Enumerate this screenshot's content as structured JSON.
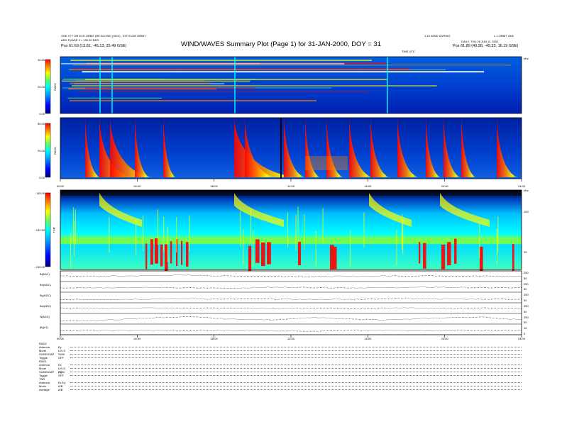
{
  "header": {
    "title": "WIND/WAVES Summary Plot (Page 1) for 31-JAN-2000, DOY = 31",
    "left_line1": "GSE X+Y OR ECE ORBIT (RE IN GSE) (GEO) - ATTITUDE ORBIT",
    "left_line2": "ARG PHASE 3 = 135.00 DEG",
    "left_line3": "Pos    61.69 (13.81, -45.13, 25.49 GSE)",
    "right_line1": "1.10 WIND DURING",
    "right_line2": "DAILY: THU 28 JUN 11, 2002",
    "right_line3": "Pos    61.89 (40.28, -45.33, 16.19 GSE)",
    "right_corner": "L 1 ORBIT orbit",
    "top_axis_label": "TIME UTC",
    "top_right_unit": "kHz"
  },
  "chart_data": [
    {
      "type": "heatmap",
      "name": "RAD2",
      "ylabel": "RAD2",
      "yticks": [
        "0.00",
        "20.00",
        "40.00"
      ],
      "ylim": [
        0,
        40
      ]
    },
    {
      "type": "heatmap",
      "name": "RAD1",
      "ylabel": "RAD1",
      "yticks": [
        "0.00",
        "20.00",
        "50.00"
      ],
      "ylim": [
        0,
        50
      ]
    },
    {
      "type": "heatmap",
      "name": "TNR",
      "ylabel": "TNR",
      "yticks": [
        "-150.00",
        "-132.50",
        "-115.00"
      ],
      "ylim": [
        -150,
        -115
      ],
      "right_ticks": [
        "100",
        "10"
      ],
      "right_unit": "kHz",
      "xticks": [
        "00:00",
        "04:00",
        "08:00",
        "12:00",
        "16:00",
        "20:00",
        "24:00"
      ]
    },
    {
      "type": "line",
      "name": "magnetometer-traces",
      "series": [
        {
          "name": "B(ADC)",
          "values": [
            0.52,
            0.5,
            0.55,
            0.6,
            0.52,
            0.5,
            0.48,
            0.5,
            0.53,
            0.55,
            0.51,
            0.5
          ]
        },
        {
          "name": "Bx(ADC)",
          "values": [
            0.4,
            0.42,
            0.45,
            0.4,
            0.38,
            0.46,
            0.44,
            0.41,
            0.43,
            0.47,
            0.42,
            0.4
          ]
        },
        {
          "name": "By(ADC)",
          "values": [
            0.3,
            0.32,
            0.35,
            0.38,
            0.34,
            0.36,
            0.31,
            0.33,
            0.4,
            0.37,
            0.35,
            0.33
          ]
        },
        {
          "name": "Bz(ADC)",
          "values": [
            0.5,
            0.48,
            0.52,
            0.49,
            0.51,
            0.47,
            0.5,
            0.46,
            0.52,
            0.48,
            0.5,
            0.49
          ]
        },
        {
          "name": "N(ADC)",
          "values": [
            0.3,
            0.35,
            0.55,
            0.7,
            0.48,
            0.4,
            0.62,
            0.45,
            0.4,
            0.58,
            0.66,
            0.42
          ]
        },
        {
          "name": "|B|(nT)",
          "values": [
            0.4,
            0.38,
            0.42,
            0.36,
            0.4,
            0.38,
            0.35,
            0.39,
            0.41,
            0.37,
            0.4,
            0.38
          ]
        }
      ],
      "right_ticks": [
        "250",
        "50",
        "250",
        "50",
        "250",
        "50",
        "250",
        "50",
        "250",
        "50",
        "10",
        "0"
      ],
      "xticks": [
        "00:00",
        "04:00",
        "08:00",
        "12:00",
        "16:00",
        "20:00",
        "24:00"
      ]
    }
  ],
  "settings": {
    "groups": [
      {
        "name": "RAD2",
        "rows": [
          {
            "label": "Antenna",
            "value": "Ey"
          },
          {
            "label": "Mode",
            "value": "LIN S"
          },
          {
            "label": "SUMD/GAP",
            "value": "SUM"
          },
          {
            "label": "Toggle",
            "value": "OFF"
          }
        ]
      },
      {
        "name": "RAD1",
        "rows": [
          {
            "label": "Antenna",
            "value": "Ex"
          },
          {
            "label": "Mode",
            "value": "LIN S (X)"
          },
          {
            "label": "SUMD/GAP",
            "value": "SUM"
          },
          {
            "label": "Toggle",
            "value": "OFF"
          }
        ]
      },
      {
        "name": "TNR",
        "rows": [
          {
            "label": "Antenna",
            "value": "Ex Ey"
          },
          {
            "label": "Mode",
            "value": "A/B"
          },
          {
            "label": "Average",
            "value": "A/B"
          }
        ]
      }
    ]
  },
  "colors": {
    "colorbar": [
      "#000080",
      "#0000ff",
      "#00a0ff",
      "#00ffff",
      "#60ff60",
      "#ffff00",
      "#ff8000",
      "#ff0000"
    ],
    "background_band": "#0030c0",
    "trace": "#000000"
  }
}
